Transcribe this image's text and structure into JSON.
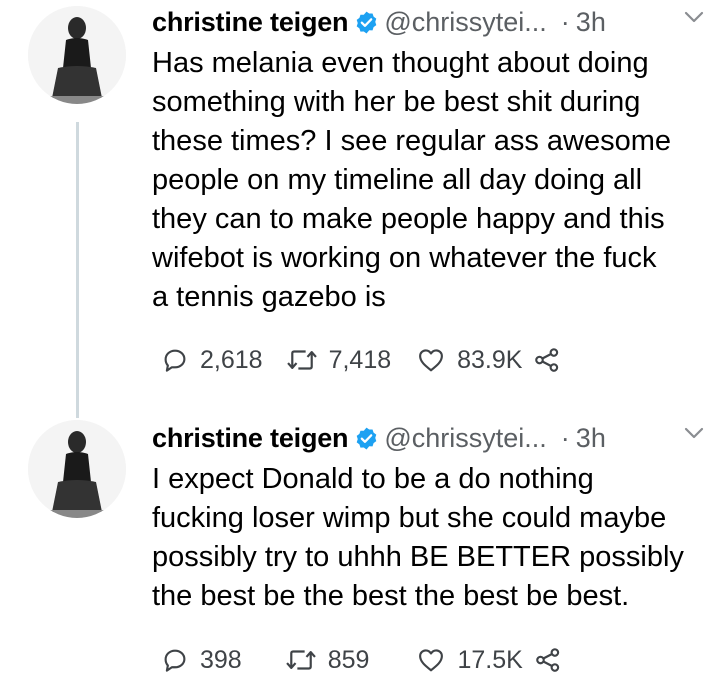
{
  "tweets": [
    {
      "name": "christine teigen",
      "handle": "@chrissytei...",
      "separator": "·",
      "time": "3h",
      "lines": [
        "Has melania even thought about doing",
        "something with her be best shit during",
        "these times? I see regular ass awesome",
        "people on my timeline all day doing all",
        "they can to make people happy and this",
        "wifebot is working on whatever the fuck",
        "a tennis gazebo is"
      ],
      "replies": "2,618",
      "retweets": "7,418",
      "likes": "83.9K"
    },
    {
      "name": "christine teigen",
      "handle": "@chrissytei...",
      "separator": "·",
      "time": "3h",
      "lines": [
        "I expect Donald to be a do nothing",
        "fucking loser wimp but she could maybe",
        "possibly try to uhhh BE BETTER possibly",
        "the best be the best the best be best."
      ],
      "replies": "398",
      "retweets": "859",
      "likes": "17.5K"
    }
  ],
  "colors": {
    "verified": "#1da1f2",
    "muted": "#5b5f63",
    "thread": "#cfd9de"
  },
  "icons": [
    "reply-icon",
    "retweet-icon",
    "like-icon",
    "share-icon",
    "verified-icon",
    "caret-down-icon"
  ]
}
